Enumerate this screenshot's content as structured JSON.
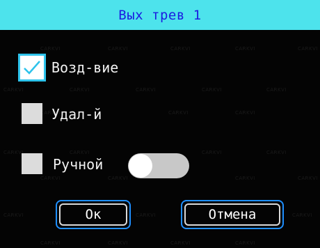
{
  "dialog": {
    "title": "Вых трев 1"
  },
  "watermark_text": "CARKVI",
  "options": {
    "impact": {
      "label": "Возд-вие",
      "checked": true
    },
    "remote": {
      "label": "Удал-й",
      "checked": false
    },
    "manual": {
      "label": "Ручной",
      "checked": false,
      "toggle_on": false
    }
  },
  "buttons": {
    "ok_label": "Ок",
    "cancel_label": "Отмена"
  },
  "colors": {
    "title_bar": "#4de3ec",
    "title_text": "#1c1ce0",
    "focus_border": "#2ec3eb",
    "button_border": "#1e8fff",
    "background": "#040404"
  }
}
